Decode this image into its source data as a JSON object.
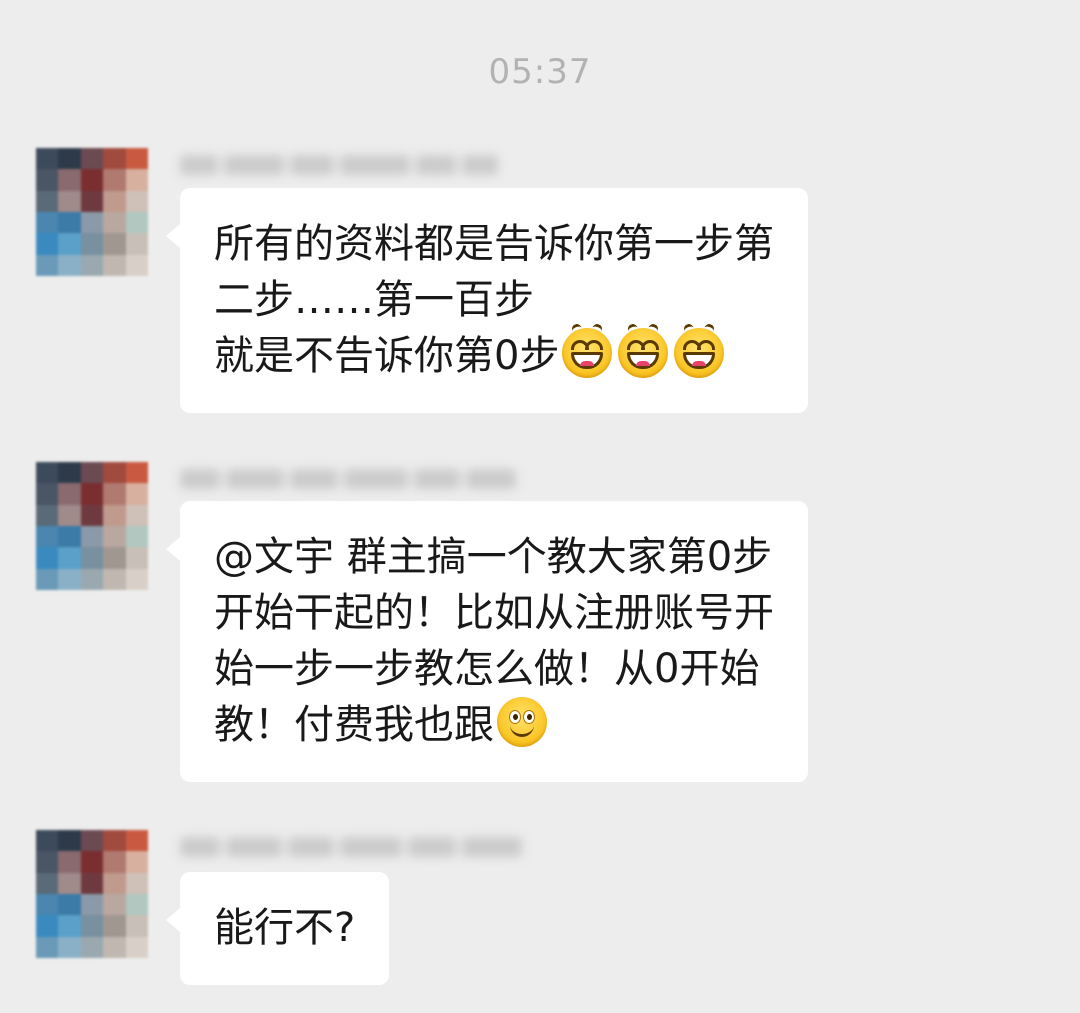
{
  "chat": {
    "timestamp": "05:37",
    "messages": [
      {
        "sender": "",
        "lines": [
          "所有的资料都是告诉你第一步第",
          "二步……第一百步",
          "就是不告诉你第0步"
        ],
        "emojis": [
          "grin-emoji",
          "grin-emoji",
          "grin-emoji"
        ]
      },
      {
        "sender": "",
        "lines": [
          "@文宇 群主搞一个教大家第0步",
          "开始干起的！比如从注册账号开",
          "始一步一步教怎么做！从0开始",
          "教！付费我也跟"
        ],
        "emojis": [
          "smile-emoji"
        ]
      },
      {
        "sender": "",
        "lines": [
          "能行不?"
        ],
        "emojis": []
      }
    ]
  },
  "colors": {
    "background": "#ededed",
    "bubble": "#ffffff",
    "text": "#191919",
    "timestamp": "#b2b2b2"
  },
  "icons": {
    "avatar": "pixelated-avatar",
    "grin": "grin-emoji",
    "smile": "smile-emoji"
  }
}
